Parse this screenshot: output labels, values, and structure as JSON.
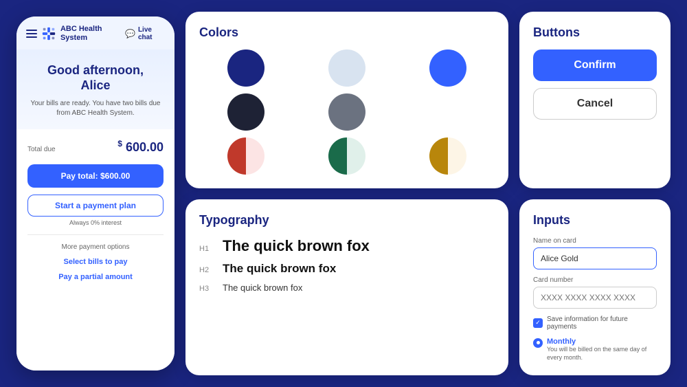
{
  "mobile": {
    "header": {
      "brand": "ABC Health\nSystem",
      "live_chat": "Live chat"
    },
    "hero": {
      "greeting": "Good afternoon,\nAlice",
      "subtitle": "Your bills are ready. You have two bills\ndue from ABC Health System."
    },
    "total_label": "Total due",
    "total_amount": "600.00",
    "pay_btn": "Pay total: $600.00",
    "payment_plan_btn": "Start a payment plan",
    "payment_plan_sub": "Always 0% interest",
    "more_options": "More payment options",
    "link1": "Select bills to pay",
    "link2": "Pay a partial amount"
  },
  "colors_panel": {
    "title": "Colors",
    "swatches": [
      {
        "type": "solid",
        "color": "#1a2580"
      },
      {
        "type": "solid",
        "color": "#d8e3f0"
      },
      {
        "type": "solid",
        "color": "#3361ff"
      },
      {
        "type": "solid",
        "color": "#1e2235"
      },
      {
        "type": "solid",
        "color": "#6b7280"
      },
      {
        "type": "half",
        "left": "#c0392b",
        "right": "#fce4e4"
      },
      {
        "type": "half",
        "left": "#1a6b4a",
        "right": "#e0f0ea"
      },
      {
        "type": "half",
        "left": "#b8860b",
        "right": "#fdf5e6"
      }
    ]
  },
  "buttons_panel": {
    "title": "Buttons",
    "confirm_label": "Confirm",
    "cancel_label": "Cancel"
  },
  "typography_panel": {
    "title": "Typography",
    "h1_label": "H1",
    "h1_text": "The quick brown fox",
    "h2_label": "H2",
    "h2_text": "The quick brown fox",
    "h3_label": "H3",
    "h3_text": "The quick brown fox"
  },
  "inputs_panel": {
    "title": "Inputs",
    "name_label": "Name on card",
    "name_value": "Alice Gold",
    "card_label": "Card number",
    "card_placeholder": "XXXX XXXX XXXX XXXX",
    "save_label": "Save information for future payments",
    "radio_title": "Monthly",
    "radio_desc": "You will be billed on the same day of every month."
  }
}
